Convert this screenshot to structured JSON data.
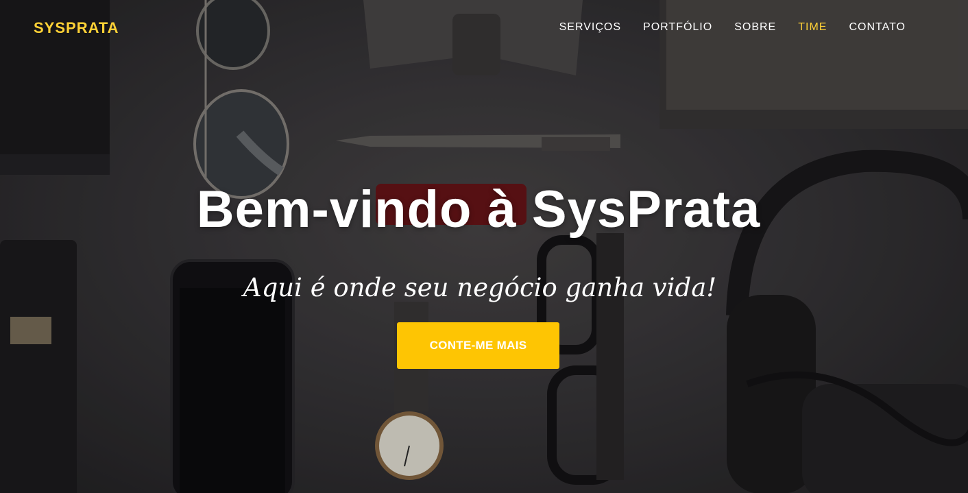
{
  "brand": {
    "name": "SYSPRATA",
    "color": "#fed136"
  },
  "nav": {
    "items": [
      {
        "label": "SERVIÇOS",
        "active": false
      },
      {
        "label": "PORTFÓLIO",
        "active": false
      },
      {
        "label": "SOBRE",
        "active": false
      },
      {
        "label": "TIME",
        "active": true
      },
      {
        "label": "CONTATO",
        "active": false
      }
    ]
  },
  "hero": {
    "title": "Bem-vindo à SysPrata",
    "subtitle": "Aqui é onde seu negócio ganha vida!",
    "cta_label": "CONTE-ME MAIS",
    "cta_color": "#fec503"
  }
}
